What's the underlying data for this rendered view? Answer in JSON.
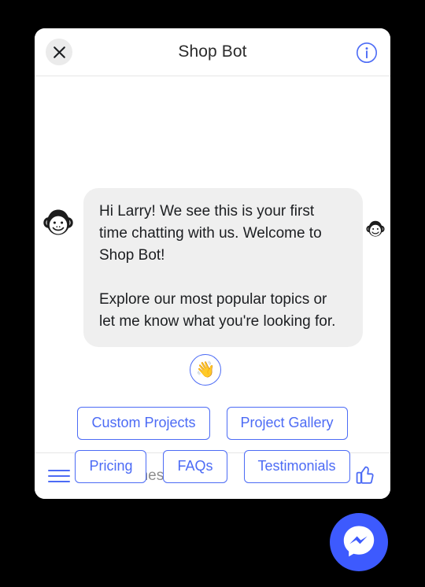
{
  "header": {
    "title": "Shop Bot",
    "close_icon": "close-icon",
    "info_icon": "info-icon"
  },
  "conversation": {
    "avatar_icon": "monkey-avatar-icon",
    "avatar_small_icon": "monkey-avatar-small-icon",
    "message": {
      "paragraph_1": "Hi Larry! We see this is your first time chatting with us. Welcome to Shop Bot!",
      "paragraph_2": "Explore our most popular topics or let me know what you're looking for."
    },
    "reaction": {
      "emoji": "👋",
      "name": "waving-hand-reaction"
    }
  },
  "quick_replies": {
    "row_1": [
      {
        "label": "Custom Projects"
      },
      {
        "label": "Project Gallery"
      }
    ],
    "row_2": [
      {
        "label": "Pricing"
      },
      {
        "label": "FAQs"
      },
      {
        "label": "Testimonials"
      }
    ]
  },
  "composer": {
    "menu_icon": "hamburger-menu-icon",
    "placeholder": "Type a message...",
    "value": "",
    "image_icon": "image-icon",
    "thumbs_up_icon": "thumbs-up-icon"
  },
  "launcher": {
    "icon": "messenger-logo-icon"
  },
  "colors": {
    "brand_blue": "#3d5afe",
    "accent_blue": "#4c6bf5",
    "bubble_gray": "#efefef",
    "page_background": "#000000"
  }
}
